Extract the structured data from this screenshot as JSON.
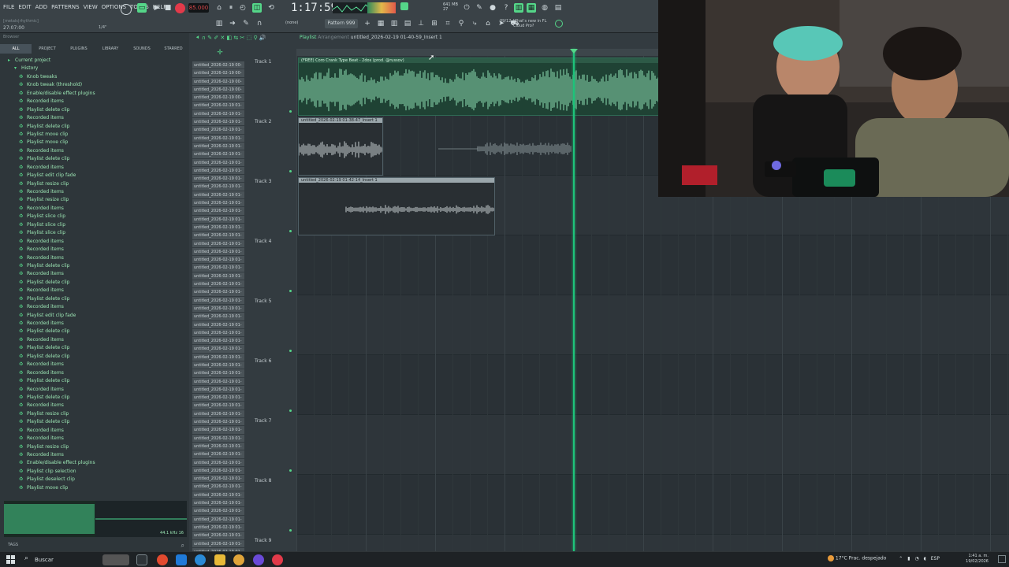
{
  "menu": [
    "FILE",
    "EDIT",
    "ADD",
    "PATTERNS",
    "VIEW",
    "OPTIONS",
    "TOOLS",
    "HELP"
  ],
  "topbar": {
    "hint": "[metals|rhythmic]",
    "position": "27:07:00",
    "swing": "1/4\"",
    "tempo": "85.000",
    "clock": "1:17:59",
    "cpu_memory": "641 MB",
    "cpu_num": "27",
    "pattern": "Pattern 999",
    "snap": "(none)",
    "news_date": "09/12",
    "news_text": "What's new in FL Cloud Pro?"
  },
  "browser": {
    "title": "Browser",
    "tabs": [
      "ALL",
      "PROJECT",
      "PLUGINS",
      "LIBRARY",
      "SOUNDS",
      "STARRED"
    ],
    "root": "Current project",
    "history": "History",
    "items": [
      "Knob tweaks",
      "Knob tweak (threshold)",
      "Enable/disable effect plugins",
      "Recorded items",
      "Playlist delete clip",
      "Recorded items",
      "Playlist delete clip",
      "Playlist move clip",
      "Playlist move clip",
      "Recorded items",
      "Playlist delete clip",
      "Recorded items",
      "Playlist edit clip fade",
      "Playlist resize clip",
      "Recorded items",
      "Playlist resize clip",
      "Recorded items",
      "Playlist slice clip",
      "Playlist slice clip",
      "Playlist slice clip",
      "Recorded items",
      "Recorded items",
      "Recorded items",
      "Playlist delete clip",
      "Recorded items",
      "Playlist delete clip",
      "Recorded items",
      "Playlist delete clip",
      "Recorded items",
      "Playlist edit clip fade",
      "Recorded items",
      "Playlist delete clip",
      "Recorded items",
      "Playlist delete clip",
      "Playlist delete clip",
      "Recorded items",
      "Recorded items",
      "Playlist delete clip",
      "Recorded items",
      "Playlist delete clip",
      "Recorded items",
      "Playlist resize clip",
      "Playlist delete clip",
      "Recorded items",
      "Recorded items",
      "Playlist resize clip",
      "Recorded items",
      "Enable/disable effect plugins",
      "Playlist clip selection",
      "Playlist deselect clip",
      "Playlist move clip"
    ],
    "sample_info": "44.1 kHz 16",
    "footer": "TAGS"
  },
  "playlist": {
    "title": "Playlist",
    "subtitle": "Arrangement",
    "file": "untitled_2026-02-19 01-40-59_Insert 1",
    "clip_list": [
      "untitled_2026-02-19 00-",
      "untitled_2026-02-19 00-",
      "untitled_2026-02-19 00-",
      "untitled_2026-02-19 00-",
      "untitled_2026-02-19 00-",
      "untitled_2026-02-19 01-",
      "untitled_2026-02-19 01-",
      "untitled_2026-02-19 01-",
      "untitled_2026-02-19 01-",
      "untitled_2026-02-19 01-",
      "untitled_2026-02-19 01-",
      "untitled_2026-02-19 01-",
      "untitled_2026-02-19 01-",
      "untitled_2026-02-19 01-",
      "untitled_2026-02-19 01-",
      "untitled_2026-02-19 01-",
      "untitled_2026-02-19 01-",
      "untitled_2026-02-19 01-",
      "untitled_2026-02-19 01-",
      "untitled_2026-02-19 01-",
      "untitled_2026-02-19 01-",
      "untitled_2026-02-19 01-",
      "untitled_2026-02-19 01-",
      "untitled_2026-02-19 01-",
      "untitled_2026-02-19 01-",
      "untitled_2026-02-19 01-",
      "untitled_2026-02-19 01-",
      "untitled_2026-02-19 01-",
      "untitled_2026-02-19 01-",
      "untitled_2026-02-19 01-",
      "untitled_2026-02-19 01-",
      "untitled_2026-02-19 01-",
      "untitled_2026-02-19 01-",
      "untitled_2026-02-19 01-",
      "untitled_2026-02-19 01-",
      "untitled_2026-02-19 01-",
      "untitled_2026-02-19 01-",
      "untitled_2026-02-19 01-",
      "untitled_2026-02-19 01-",
      "untitled_2026-02-19 01-",
      "untitled_2026-02-19 01-",
      "untitled_2026-02-19 01-",
      "untitled_2026-02-19 01-",
      "untitled_2026-02-19 01-",
      "untitled_2026-02-19 01-",
      "untitled_2026-02-19 01-",
      "untitled_2026-02-19 01-",
      "untitled_2026-02-19 01-",
      "untitled_2026-02-19 01-",
      "untitled_2026-02-19 01-",
      "untitled_2026-02-19 01-",
      "untitled_2026-02-19 01-",
      "untitled_2026-02-19 01-",
      "untitled_2026-02-19 01-",
      "untitled_2026-02-19 01-",
      "untitled_2026-02-19 01-",
      "untitled_2026-02-19 01-",
      "untitled_2026-02-19 01-",
      "untitled_2026-02-19 01-",
      "untitled_2026-02-19 01-",
      "untitled_2026-02-19 01-"
    ],
    "tracks": [
      "Track 1",
      "Track 2",
      "Track 3",
      "Track 4",
      "Track 5",
      "Track 6",
      "Track 7",
      "Track 8",
      "Track 9"
    ],
    "clips": [
      {
        "label": "(FREE) Coro  Crank Type Beat - 2dos (prod. @russov)",
        "style": "green"
      },
      {
        "label": "untitled_2026-02-19 01-38-47_Insert 1",
        "style": "grey"
      },
      {
        "label": "untitled_2026-02-19 01-42-14_Insert 1",
        "style": "grey"
      }
    ]
  },
  "taskbar": {
    "search": "Buscar",
    "weather": "17°C  Prac. despejado",
    "lang": "ESP",
    "time": "1:41 a. m.",
    "date": "19/02/2026"
  }
}
